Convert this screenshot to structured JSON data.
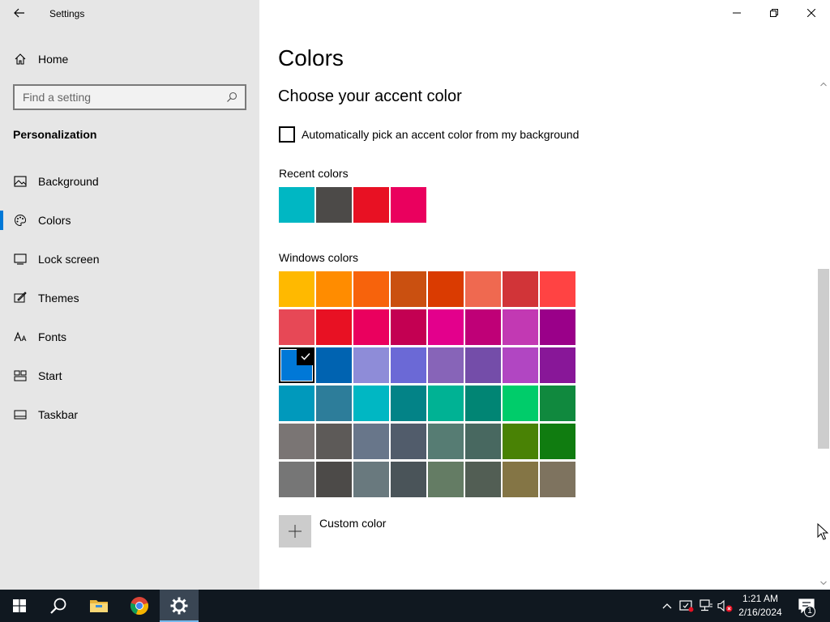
{
  "window": {
    "title": "Settings"
  },
  "sidebar": {
    "home_label": "Home",
    "search_placeholder": "Find a setting",
    "section_title": "Personalization",
    "items": [
      {
        "label": "Background",
        "icon": "image-icon"
      },
      {
        "label": "Colors",
        "icon": "palette-icon",
        "selected": true
      },
      {
        "label": "Lock screen",
        "icon": "lock-screen-icon"
      },
      {
        "label": "Themes",
        "icon": "themes-icon"
      },
      {
        "label": "Fonts",
        "icon": "fonts-icon"
      },
      {
        "label": "Start",
        "icon": "start-icon"
      },
      {
        "label": "Taskbar",
        "icon": "taskbar-icon"
      }
    ]
  },
  "main": {
    "page_title": "Colors",
    "subtitle": "Choose your accent color",
    "auto_pick_label": "Automatically pick an accent color from my background",
    "auto_pick_checked": false,
    "recent_label": "Recent colors",
    "recent_colors": [
      "#00b7c3",
      "#4c4a48",
      "#e81123",
      "#ea005e"
    ],
    "windows_label": "Windows colors",
    "windows_colors": [
      [
        "#ffb900",
        "#ff8c00",
        "#f7630c",
        "#ca5010",
        "#da3b01",
        "#ef6950",
        "#d13438",
        "#ff4343"
      ],
      [
        "#e74856",
        "#e81123",
        "#ea005e",
        "#c30052",
        "#e3008c",
        "#bf0077",
        "#c239b3",
        "#9a0089"
      ],
      [
        "#0078d7",
        "#0063b1",
        "#8e8cd8",
        "#6b69d6",
        "#8764b8",
        "#744da9",
        "#b146c2",
        "#881798"
      ],
      [
        "#0099bc",
        "#2d7d9a",
        "#00b7c3",
        "#038387",
        "#00b294",
        "#018574",
        "#00cc6a",
        "#10893e"
      ],
      [
        "#7a7574",
        "#5d5a58",
        "#68768a",
        "#515c6b",
        "#567c73",
        "#486860",
        "#498205",
        "#107c10"
      ],
      [
        "#767676",
        "#4c4a48",
        "#69797e",
        "#4a5459",
        "#647c64",
        "#525e54",
        "#847545",
        "#7e735f"
      ]
    ],
    "selected_color": "#0078d7",
    "custom_color_label": "Custom color"
  },
  "taskbar": {
    "time": "1:21 AM",
    "date": "2/16/2024",
    "notification_count": "1",
    "background": "#101820"
  },
  "accent": "#0078d7"
}
